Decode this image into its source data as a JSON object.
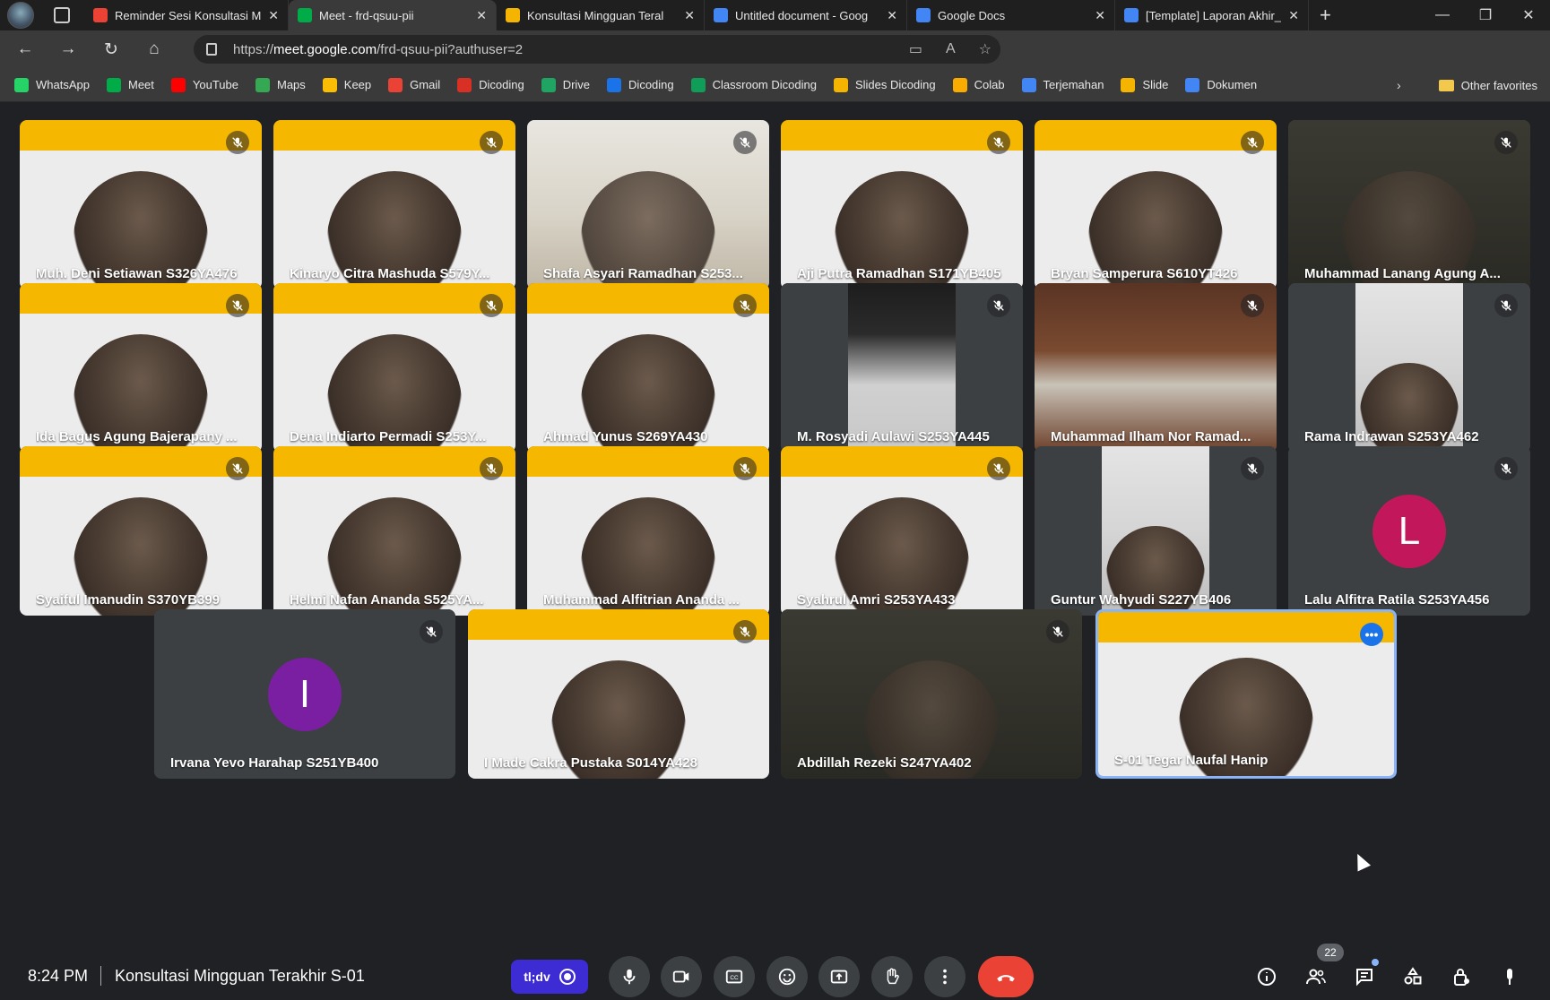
{
  "browser": {
    "tabs": [
      {
        "title": "Reminder Sesi Konsultasi M",
        "icon": "gmail-icon",
        "color": "#ea4335"
      },
      {
        "title": "Meet - frd-qsuu-pii",
        "icon": "meet-icon",
        "color": "#00ac47",
        "active": true
      },
      {
        "title": "Konsultasi Mingguan Teral",
        "icon": "slides-icon",
        "color": "#f4b400"
      },
      {
        "title": "Untitled document - Goog",
        "icon": "docs-icon",
        "color": "#4285f4"
      },
      {
        "title": "Google Docs",
        "icon": "docs-icon",
        "color": "#4285f4"
      },
      {
        "title": "[Template] Laporan Akhir_",
        "icon": "docs-icon",
        "color": "#4285f4"
      }
    ],
    "url_prefix": "https://",
    "url_host": "meet.google.com",
    "url_path": "/frd-qsuu-pii?authuser=2",
    "bookmarks": [
      {
        "label": "WhatsApp",
        "color": "#25d366"
      },
      {
        "label": "Meet",
        "color": "#00ac47"
      },
      {
        "label": "YouTube",
        "color": "#ff0000"
      },
      {
        "label": "Maps",
        "color": "#34a853"
      },
      {
        "label": "Keep",
        "color": "#fbbc04"
      },
      {
        "label": "Gmail",
        "color": "#ea4335"
      },
      {
        "label": "Dicoding",
        "color": "#d93025"
      },
      {
        "label": "Drive",
        "color": "#1fa463"
      },
      {
        "label": "Dicoding",
        "color": "#1a73e8"
      },
      {
        "label": "Classroom Dicoding",
        "color": "#0f9d58"
      },
      {
        "label": "Slides Dicoding",
        "color": "#f4b400"
      },
      {
        "label": "Colab",
        "color": "#f9ab00"
      },
      {
        "label": "Terjemahan",
        "color": "#4285f4"
      },
      {
        "label": "Slide",
        "color": "#f4b400"
      },
      {
        "label": "Dokumen",
        "color": "#4285f4"
      }
    ],
    "other_favorites": "Other favorites"
  },
  "meeting": {
    "time": "8:24 PM",
    "title": "Konsultasi Mingguan Terakhir S-01",
    "participant_count": "22",
    "tldv_label": "tl;dv",
    "participants": [
      {
        "name": "Muh. Deni Setiawan S326YA476",
        "style": "yellow"
      },
      {
        "name": "Kinaryo Citra Mashuda S579Y...",
        "style": "yellow"
      },
      {
        "name": "Shafa Asyari Ramadhan S253...",
        "style": "room"
      },
      {
        "name": "Aji Putra Ramadhan S171YB405",
        "style": "yellow"
      },
      {
        "name": "Bryan Samperura S610YT426",
        "style": "yellow"
      },
      {
        "name": "Muhammad Lanang Agung A...",
        "style": "dark"
      },
      {
        "name": "Ida Bagus Agung Bajerapany ...",
        "style": "yellow"
      },
      {
        "name": "Dena Indiarto Permadi S253Y...",
        "style": "yellow"
      },
      {
        "name": "Ahmad Yunus S269YA430",
        "style": "yellow"
      },
      {
        "name": "M. Rosyadi Aulawi S253YA445",
        "style": "portrait-dark"
      },
      {
        "name": "Muhammad Ilham Nor Ramad...",
        "style": "cabin"
      },
      {
        "name": "Rama Indrawan S253YA462",
        "style": "portrait-light"
      },
      {
        "name": "Syaiful Imanudin S370YB399",
        "style": "yellow"
      },
      {
        "name": "Helmi Nafan Ananda S525YA...",
        "style": "yellow"
      },
      {
        "name": "Muhammad Alfitrian Ananda ...",
        "style": "yellow"
      },
      {
        "name": "Syahrul Amri S253YA433",
        "style": "yellow"
      },
      {
        "name": "Guntur Wahyudi S227YB406",
        "style": "portrait-light"
      },
      {
        "name": "Lalu Alfitra Ratila S253YA456",
        "style": "avatar",
        "initial": "L",
        "avatar_color": "#c2185b"
      },
      {
        "name": "Irvana Yevo Harahap S251YB400",
        "style": "avatar",
        "initial": "I",
        "avatar_color": "#7b1fa2"
      },
      {
        "name": "I Made Cakra Pustaka S014YA428",
        "style": "yellow"
      },
      {
        "name": "Abdillah Rezeki S247YA402",
        "style": "dark"
      },
      {
        "name": "S-01 Tegar Naufal Hanip",
        "style": "yellow",
        "self": true
      }
    ]
  }
}
